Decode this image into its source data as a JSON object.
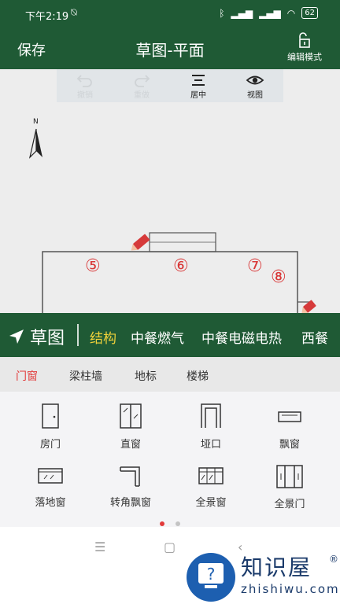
{
  "status_bar": {
    "time": "下午2:19",
    "battery": "62"
  },
  "app_bar": {
    "save_label": "保存",
    "title": "草图-平面",
    "edit_mode_label": "编辑模式"
  },
  "toolbar": {
    "undo": "撤销",
    "redo": "重做",
    "center": "居中",
    "view": "视图"
  },
  "compass": {
    "label": "N"
  },
  "rooms": [
    "⑤",
    "⑥",
    "⑦",
    "⑧"
  ],
  "categories": {
    "sketch_label": "草图",
    "items": [
      "结构",
      "中餐燃气",
      "中餐电磁电热",
      "西餐"
    ]
  },
  "subtabs": [
    "门窗",
    "梁柱墙",
    "地标",
    "楼梯"
  ],
  "grid_items": [
    {
      "label": "房门",
      "icon": "door-icon"
    },
    {
      "label": "直窗",
      "icon": "straight-window-icon"
    },
    {
      "label": "垭口",
      "icon": "archway-icon"
    },
    {
      "label": "飘窗",
      "icon": "bay-window-icon"
    },
    {
      "label": "落地窗",
      "icon": "floor-window-icon"
    },
    {
      "label": "转角飘窗",
      "icon": "corner-bay-window-icon"
    },
    {
      "label": "全景窗",
      "icon": "panorama-window-icon"
    },
    {
      "label": "全景门",
      "icon": "panorama-door-icon"
    }
  ],
  "pagination": {
    "active": 0,
    "total": 2
  },
  "watermark": {
    "brand": "知识屋",
    "url": "zhishiwu.com"
  },
  "colors": {
    "primary": "#1f5a35",
    "accent_yellow": "#f0d23a",
    "accent_red": "#e23a3a"
  }
}
